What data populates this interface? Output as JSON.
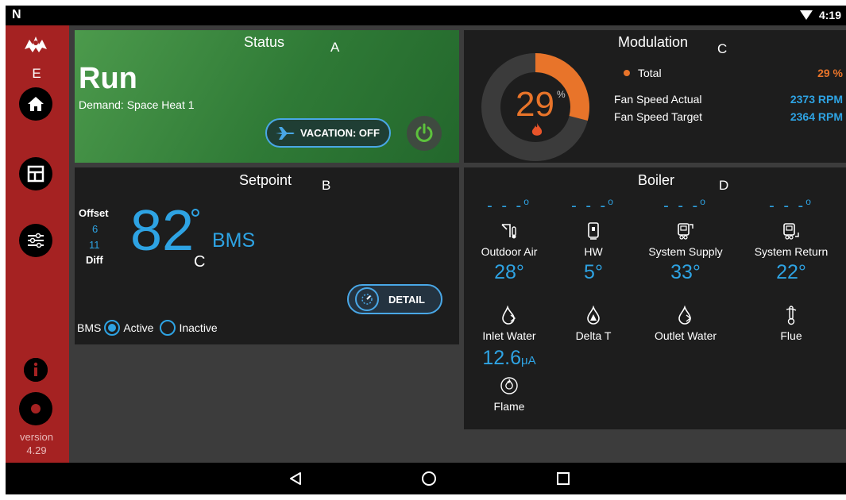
{
  "status_bar": {
    "time": "4:19",
    "left_icon": "n-logo-icon",
    "wifi_icon": "wifi-icon"
  },
  "sidebar": {
    "e_label": "E",
    "nav_icons": [
      "home-icon",
      "dashboard-icon",
      "settings-sliders-icon",
      "info-icon",
      "gear-icon"
    ],
    "version_label": "version",
    "version_number": "4.29"
  },
  "status_panel": {
    "title": "Status",
    "letter": "A",
    "state": "Run",
    "demand": "Demand: Space Heat 1",
    "vacation_label": "VACATION: OFF",
    "colors": {
      "bg": "#3a8a3e",
      "accent": "#49a7e6"
    }
  },
  "setpoint_panel": {
    "title": "Setpoint",
    "letter": "B",
    "offset_label": "Offset",
    "offset_value": "6",
    "diff_value": "11",
    "diff_label": "Diff",
    "setpoint_value": "82",
    "unit": "C",
    "mode": "BMS",
    "detail_label": "DETAIL",
    "bms_label": "BMS",
    "bms_options": [
      "Active",
      "Inactive"
    ],
    "bms_selected": "Active"
  },
  "modulation_panel": {
    "title": "Modulation",
    "letter": "C",
    "gauge_value": "29",
    "gauge_unit": "%",
    "gauge_fraction": 0.29,
    "total_label": "Total",
    "total_value": "29 %",
    "fan_actual_label": "Fan Speed Actual",
    "fan_actual_value": "2373 RPM",
    "fan_target_label": "Fan Speed Target",
    "fan_target_value": "2364 RPM",
    "colors": {
      "orange": "#e8742a",
      "blue": "#2ea3e3"
    }
  },
  "boiler_panel": {
    "title": "Boiler",
    "letter": "D",
    "top_row": [
      {
        "placeholder": "- - -",
        "label": "Outdoor Air",
        "value": "28°",
        "icon": "outdoor-air-icon"
      },
      {
        "placeholder": "- - -",
        "label": "HW",
        "value": "5°",
        "icon": "hot-water-tank-icon"
      },
      {
        "placeholder": "- - -",
        "label": "System Supply",
        "value": "33°",
        "icon": "system-supply-icon"
      },
      {
        "placeholder": "- - -",
        "label": "System Return",
        "value": "22°",
        "icon": "system-return-icon"
      }
    ],
    "bottom_row": [
      {
        "label": "Inlet Water",
        "icon": "inlet-water-icon"
      },
      {
        "label": "Delta T",
        "icon": "delta-t-icon"
      },
      {
        "label": "Outlet Water",
        "icon": "outlet-water-icon"
      },
      {
        "label": "Flue",
        "icon": "flue-thermometer-icon"
      }
    ],
    "flame_value": "12.6",
    "flame_unit": "μA",
    "flame_label": "Flame",
    "flame_icon": "flame-icon"
  },
  "nav_bar": {
    "icons": [
      "back-icon",
      "home-circle-icon",
      "recents-icon"
    ]
  }
}
